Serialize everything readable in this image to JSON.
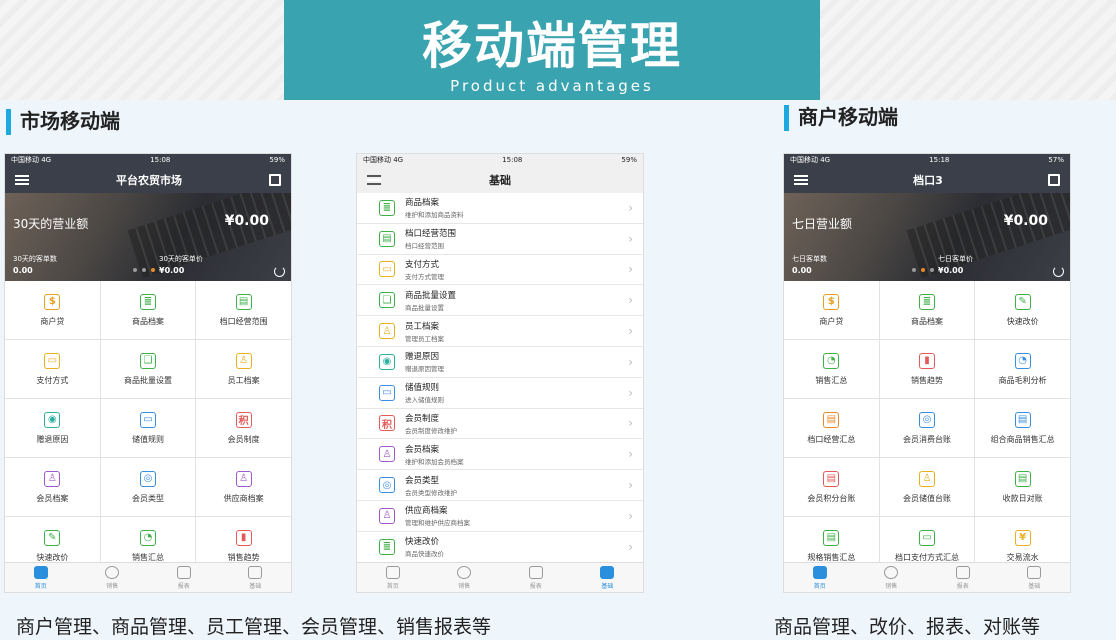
{
  "banner": {
    "title": "移动端管理",
    "subtitle": "Product advantages"
  },
  "sections": {
    "left": "市场移动端",
    "right": "商户移动端"
  },
  "captions": {
    "left": "商户管理、商品管理、员工管理、会员管理、销售报表等",
    "right": "商品管理、改价、报表、对账等"
  },
  "status": {
    "carrier": "中国移动  4G"
  },
  "tabs": [
    "首页",
    "销售",
    "报表",
    "基础"
  ],
  "phone1": {
    "time": "15:08",
    "battery": "59%",
    "title": "平台农贸市场",
    "hero": {
      "label": "30天的营业额",
      "amount": "¥0.00",
      "stat1_label": "30天的客单数",
      "stat1_value": "0.00",
      "stat2_label": "30天的客单价",
      "stat2_value": "¥0.00"
    },
    "grid": [
      {
        "label": "商户贷",
        "icon": "money-bag-icon",
        "color": "#e8a020",
        "glyph": "$"
      },
      {
        "label": "商品档案",
        "icon": "goods-file-icon",
        "color": "#3fb04a",
        "glyph": "≣"
      },
      {
        "label": "档口经营范围",
        "icon": "stall-scope-icon",
        "color": "#3fb04a",
        "glyph": "▤"
      },
      {
        "label": "支付方式",
        "icon": "payment-icon",
        "color": "#e8b020",
        "glyph": "▭"
      },
      {
        "label": "商品批量设置",
        "icon": "batch-icon",
        "color": "#3fb04a",
        "glyph": "❏"
      },
      {
        "label": "员工档案",
        "icon": "staff-icon",
        "color": "#e8b020",
        "glyph": "♙"
      },
      {
        "label": "赠退原因",
        "icon": "reason-icon",
        "color": "#2bb0a0",
        "glyph": "◉"
      },
      {
        "label": "储值规则",
        "icon": "stored-value-icon",
        "color": "#3a8ee0",
        "glyph": "▭"
      },
      {
        "label": "会员制度",
        "icon": "member-system-icon",
        "color": "#e25a5a",
        "glyph": "积"
      },
      {
        "label": "会员档案",
        "icon": "member-file-icon",
        "color": "#a05ad0",
        "glyph": "♙"
      },
      {
        "label": "会员类型",
        "icon": "member-type-icon",
        "color": "#3a8ee0",
        "glyph": "◎"
      },
      {
        "label": "供应商档案",
        "icon": "supplier-icon",
        "color": "#a05ad0",
        "glyph": "♙"
      },
      {
        "label": "快速改价",
        "icon": "quick-price-icon",
        "color": "#3fb04a",
        "glyph": "✎"
      },
      {
        "label": "销售汇总",
        "icon": "sales-summary-icon",
        "color": "#3fb04a",
        "glyph": "◔"
      },
      {
        "label": "销售趋势",
        "icon": "sales-trend-icon",
        "color": "#e25a5a",
        "glyph": "▮"
      }
    ]
  },
  "phone2": {
    "time": "15:08",
    "battery": "59%",
    "title": "基础",
    "rows": [
      {
        "name": "商品档案",
        "desc": "维护和添加商品资料",
        "icon": "goods-file-icon",
        "color": "#3fb04a",
        "glyph": "≣"
      },
      {
        "name": "档口经营范围",
        "desc": "档口经营范围",
        "icon": "stall-scope-icon",
        "color": "#3fb04a",
        "glyph": "▤"
      },
      {
        "name": "支付方式",
        "desc": "支付方式管理",
        "icon": "payment-icon",
        "color": "#e8b020",
        "glyph": "▭"
      },
      {
        "name": "商品批量设置",
        "desc": "商品批量设置",
        "icon": "batch-icon",
        "color": "#3fb04a",
        "glyph": "❏"
      },
      {
        "name": "员工档案",
        "desc": "管理员工档案",
        "icon": "staff-icon",
        "color": "#e8b020",
        "glyph": "♙"
      },
      {
        "name": "赠退原因",
        "desc": "赠退原因管理",
        "icon": "reason-icon",
        "color": "#2bb0a0",
        "glyph": "◉"
      },
      {
        "name": "储值规则",
        "desc": "进入储值规则",
        "icon": "stored-value-icon",
        "color": "#3a8ee0",
        "glyph": "▭"
      },
      {
        "name": "会员制度",
        "desc": "会员制度修改维护",
        "icon": "member-system-icon",
        "color": "#e25a5a",
        "glyph": "积"
      },
      {
        "name": "会员档案",
        "desc": "维护和添加会员档案",
        "icon": "member-file-icon",
        "color": "#a05ad0",
        "glyph": "♙"
      },
      {
        "name": "会员类型",
        "desc": "会员类型修改维护",
        "icon": "member-type-icon",
        "color": "#3a8ee0",
        "glyph": "◎"
      },
      {
        "name": "供应商档案",
        "desc": "管理和维护供应商档案",
        "icon": "supplier-icon",
        "color": "#a05ad0",
        "glyph": "♙"
      },
      {
        "name": "快速改价",
        "desc": "商品快速改价",
        "icon": "quick-price-icon",
        "color": "#3fb04a",
        "glyph": "≣"
      }
    ]
  },
  "phone3": {
    "time": "15:18",
    "battery": "57%",
    "title": "档口3",
    "hero": {
      "label": "七日营业额",
      "amount": "¥0.00",
      "stat1_label": "七日客单数",
      "stat1_value": "0.00",
      "stat2_label": "七日客单价",
      "stat2_value": "¥0.00"
    },
    "grid": [
      {
        "label": "商户贷",
        "icon": "money-bag-icon",
        "color": "#e8a020",
        "glyph": "$"
      },
      {
        "label": "商品档案",
        "icon": "goods-file-icon",
        "color": "#3fb04a",
        "glyph": "≣"
      },
      {
        "label": "快速改价",
        "icon": "quick-price-icon",
        "color": "#3fb04a",
        "glyph": "✎"
      },
      {
        "label": "销售汇总",
        "icon": "sales-summary-icon",
        "color": "#3fb04a",
        "glyph": "◔"
      },
      {
        "label": "销售趋势",
        "icon": "sales-trend-icon",
        "color": "#e25a5a",
        "glyph": "▮"
      },
      {
        "label": "商品毛利分析",
        "icon": "profit-analysis-icon",
        "color": "#3a8ee0",
        "glyph": "◔"
      },
      {
        "label": "档口经营汇总",
        "icon": "stall-summary-icon",
        "color": "#e88a2a",
        "glyph": "▤"
      },
      {
        "label": "会员消费台账",
        "icon": "member-consume-icon",
        "color": "#3a8ee0",
        "glyph": "◎"
      },
      {
        "label": "组合商品销售汇总",
        "icon": "combo-sales-icon",
        "color": "#3a8ee0",
        "glyph": "▤"
      },
      {
        "label": "会员积分台账",
        "icon": "member-points-icon",
        "color": "#e25a5a",
        "glyph": "▤"
      },
      {
        "label": "会员储值台账",
        "icon": "member-stored-icon",
        "color": "#e8b020",
        "glyph": "♙"
      },
      {
        "label": "收款日对账",
        "icon": "daily-reconcile-icon",
        "color": "#3fb04a",
        "glyph": "▤"
      },
      {
        "label": "规格销售汇总",
        "icon": "spec-sales-icon",
        "color": "#3fb04a",
        "glyph": "▤"
      },
      {
        "label": "档口支付方式汇总",
        "icon": "stall-payment-icon",
        "color": "#3fb04a",
        "glyph": "▭"
      },
      {
        "label": "交易流水",
        "icon": "transaction-icon",
        "color": "#e8b020",
        "glyph": "¥"
      }
    ]
  }
}
